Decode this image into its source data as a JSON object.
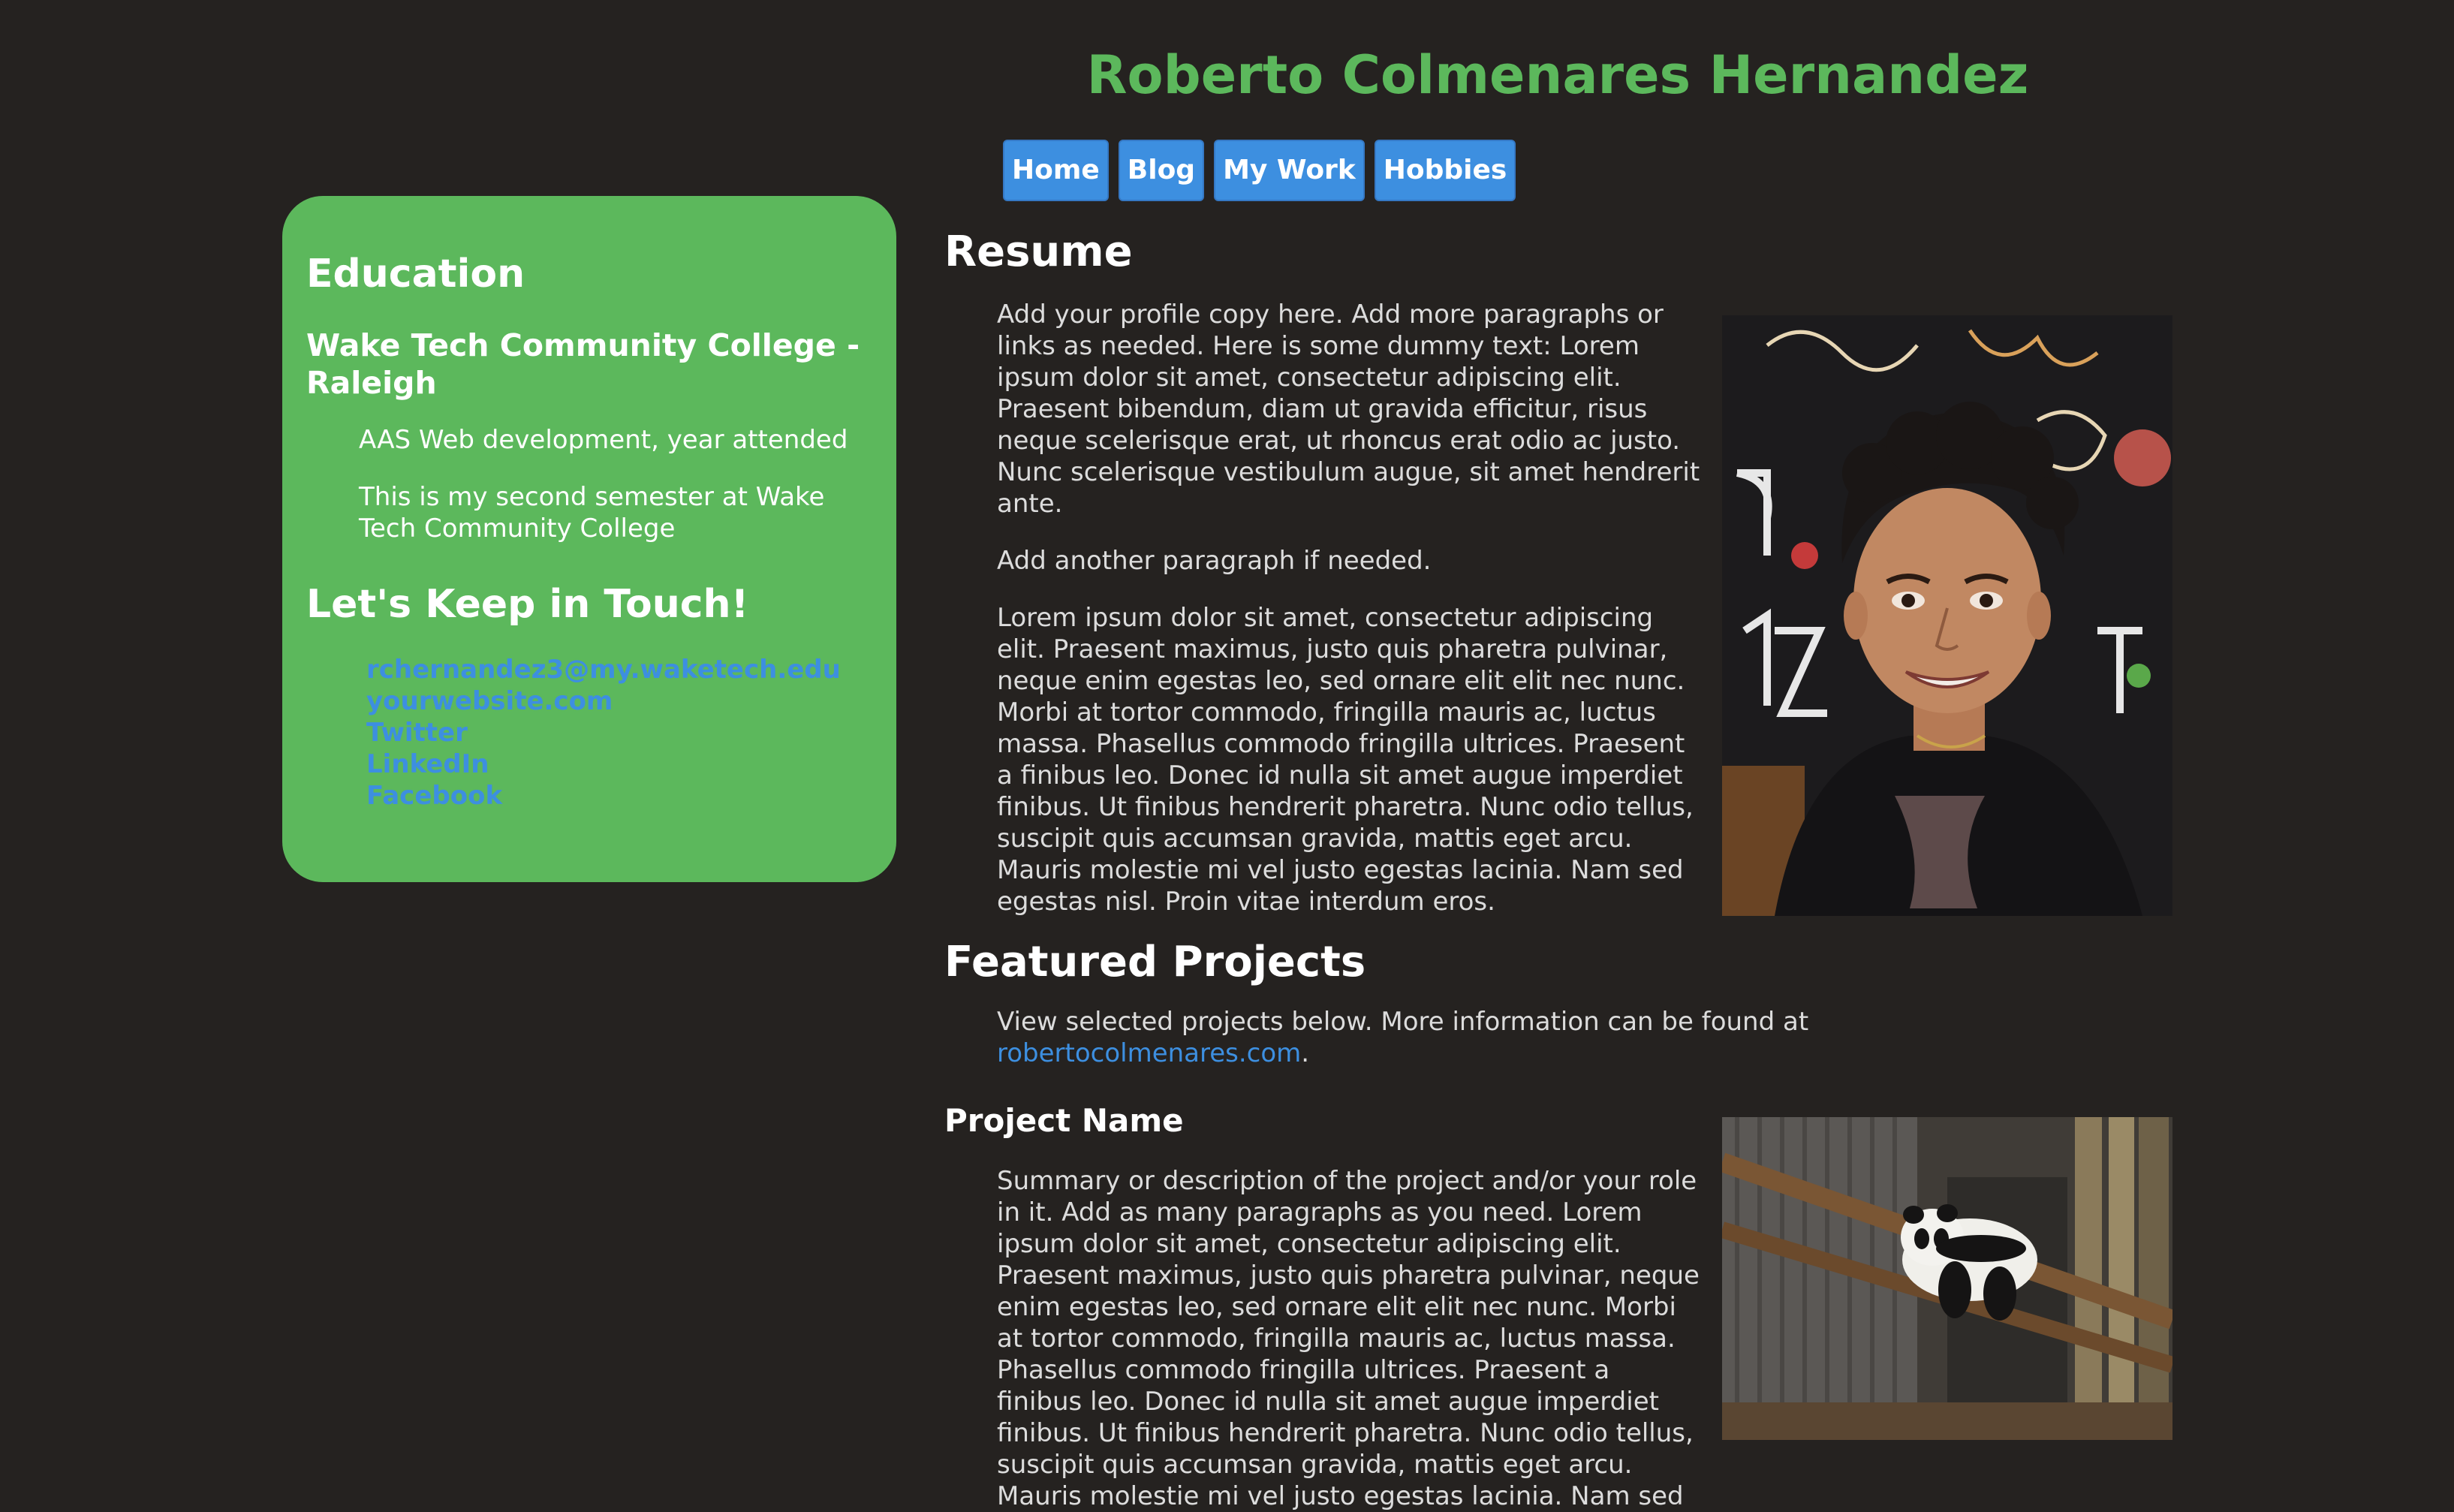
{
  "header": {
    "title": "Roberto Colmenares Hernandez"
  },
  "nav": {
    "items": [
      {
        "label": "Home"
      },
      {
        "label": "Blog"
      },
      {
        "label": "My Work"
      },
      {
        "label": "Hobbies"
      }
    ],
    "button_color": "#3d8fe0"
  },
  "sidebar": {
    "background_color": "#5cb85c",
    "education": {
      "heading": "Education",
      "school": "Wake Tech Community College - Raleigh",
      "degree": "AAS Web development, year attended",
      "note": "This is my second semester at Wake Tech Community College"
    },
    "contact": {
      "heading": "Let's Keep in Touch!",
      "links": [
        {
          "label": "rchernandez3@my.waketech.edu"
        },
        {
          "label": "yourwebsite.com"
        },
        {
          "label": "Twitter"
        },
        {
          "label": "LinkedIn"
        },
        {
          "label": "Facebook"
        }
      ]
    }
  },
  "resume": {
    "heading": "Resume",
    "paragraphs": [
      "Add your profile copy here. Add more paragraphs or links as needed. Here is some dummy text: Lorem ipsum dolor sit amet, consectetur adipiscing elit. Praesent bibendum, diam ut gravida efficitur, risus neque scelerisque erat, ut rhoncus erat odio ac justo. Nunc scelerisque vestibulum augue, sit amet hendrerit ante.",
      "Add another paragraph if needed.",
      "Lorem ipsum dolor sit amet, consectetur adipiscing elit. Praesent maximus, justo quis pharetra pulvinar, neque enim egestas leo, sed ornare elit elit nec nunc. Morbi at tortor commodo, fringilla mauris ac, luctus massa. Phasellus commodo fringilla ultrices. Praesent a finibus leo. Donec id nulla sit amet augue imperdiet finibus. Ut finibus hendrerit pharetra. Nunc odio tellus, suscipit quis accumsan gravida, mattis eget arcu. Mauris molestie mi vel justo egestas lacinia. Nam sed egestas nisl. Proin vitae interdum eros."
    ]
  },
  "featured": {
    "heading": "Featured Projects",
    "intro_prefix": "View selected projects below. More information can be found at ",
    "intro_link": "robertocolmenares.com",
    "intro_suffix": ".",
    "project": {
      "name": "Project Name",
      "description": "Summary or description of the project and/or your role in it. Add as many paragraphs as you need. Lorem ipsum dolor sit amet, consectetur adipiscing elit. Praesent maximus, justo quis pharetra pulvinar, neque enim egestas leo, sed ornare elit elit nec nunc. Morbi at tortor commodo, fringilla mauris ac, luctus massa. Phasellus commodo fringilla ultrices. Praesent a finibus leo. Donec id nulla sit amet augue imperdiet finibus. Ut finibus hendrerit pharetra. Nunc odio tellus, suscipit quis accumsan gravida, mattis eget arcu. Mauris molestie mi vel justo egestas lacinia. Nam sed"
    }
  },
  "theme": {
    "page_background": "#252220",
    "title_color": "#5cb85c",
    "link_color": "#3d8fe0"
  }
}
